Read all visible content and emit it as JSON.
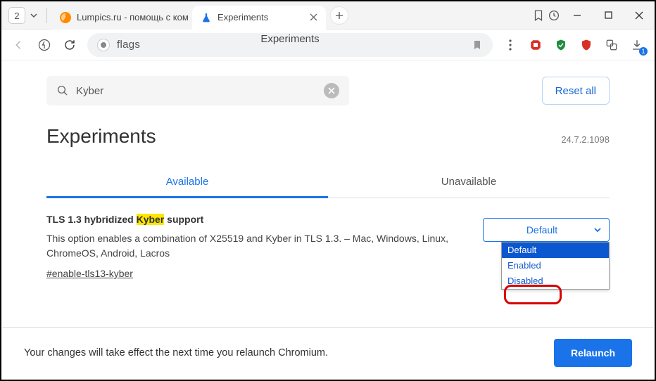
{
  "title_bar": {
    "tab_count": "2",
    "tab_inactive": {
      "label": "Lumpics.ru - помощь с ком",
      "icon": "lumpics-icon"
    },
    "tab_active": {
      "label": "Experiments",
      "icon": "flask-icon"
    }
  },
  "address_bar": {
    "url_text": "flags",
    "page_title": "Experiments"
  },
  "search": {
    "query": "Kyber",
    "reset_button": "Reset all"
  },
  "heading": "Experiments",
  "version": "24.7.2.1098",
  "page_tabs": {
    "available": "Available",
    "unavailable": "Unavailable"
  },
  "flag": {
    "title_prefix": "TLS 1.3 hybridized ",
    "title_highlight": "Kyber",
    "title_suffix": " support",
    "description": "This option enables a combination of X25519 and Kyber in TLS 1.3. – Mac, Windows, Linux, ChromeOS, Android, Lacros",
    "hash": "#enable-tls13-kyber",
    "select_value": "Default",
    "options": {
      "default": "Default",
      "enabled": "Enabled",
      "disabled": "Disabled"
    }
  },
  "footer": {
    "message": "Your changes will take effect the next time you relaunch Chromium.",
    "relaunch": "Relaunch"
  }
}
